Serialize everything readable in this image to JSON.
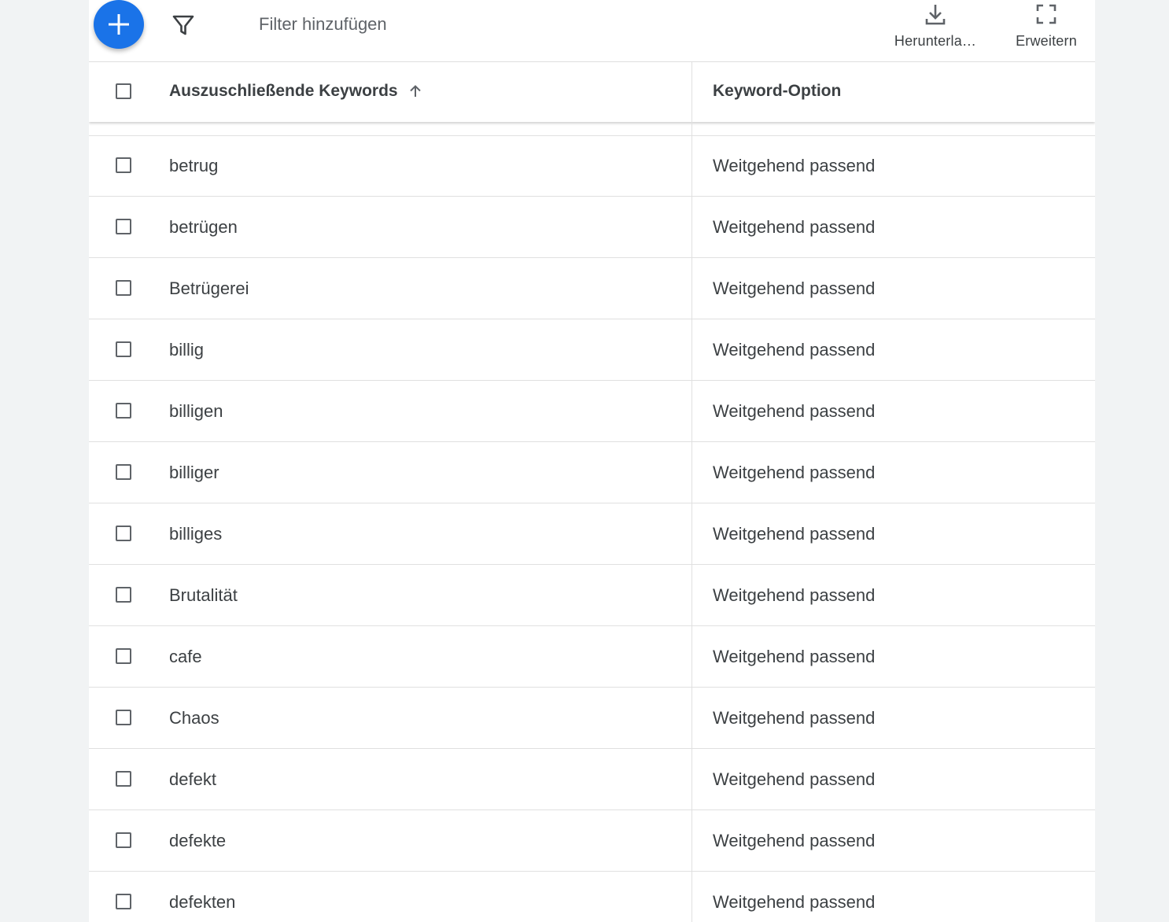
{
  "toolbar": {
    "add_icon": "plus-icon",
    "filter_icon": "funnel-icon",
    "filter_placeholder": "Filter hinzufügen",
    "download_icon": "download-icon",
    "download_label": "Herunterla…",
    "expand_icon": "fullscreen-icon",
    "expand_label": "Erweitern",
    "accent_color": "#1a73e8"
  },
  "table": {
    "columns": {
      "keyword": "Auszuschließende Keywords",
      "keyword_sort_icon": "arrow-up-icon",
      "option": "Keyword-Option"
    },
    "rows": [
      {
        "keyword": "betrug",
        "option": "Weitgehend passend"
      },
      {
        "keyword": "betrügen",
        "option": "Weitgehend passend"
      },
      {
        "keyword": "Betrügerei",
        "option": "Weitgehend passend"
      },
      {
        "keyword": "billig",
        "option": "Weitgehend passend"
      },
      {
        "keyword": "billigen",
        "option": "Weitgehend passend"
      },
      {
        "keyword": "billiger",
        "option": "Weitgehend passend"
      },
      {
        "keyword": "billiges",
        "option": "Weitgehend passend"
      },
      {
        "keyword": "Brutalität",
        "option": "Weitgehend passend"
      },
      {
        "keyword": "cafe",
        "option": "Weitgehend passend"
      },
      {
        "keyword": "Chaos",
        "option": "Weitgehend passend"
      },
      {
        "keyword": "defekt",
        "option": "Weitgehend passend"
      },
      {
        "keyword": "defekte",
        "option": "Weitgehend passend"
      },
      {
        "keyword": "defekten",
        "option": "Weitgehend passend"
      }
    ]
  }
}
